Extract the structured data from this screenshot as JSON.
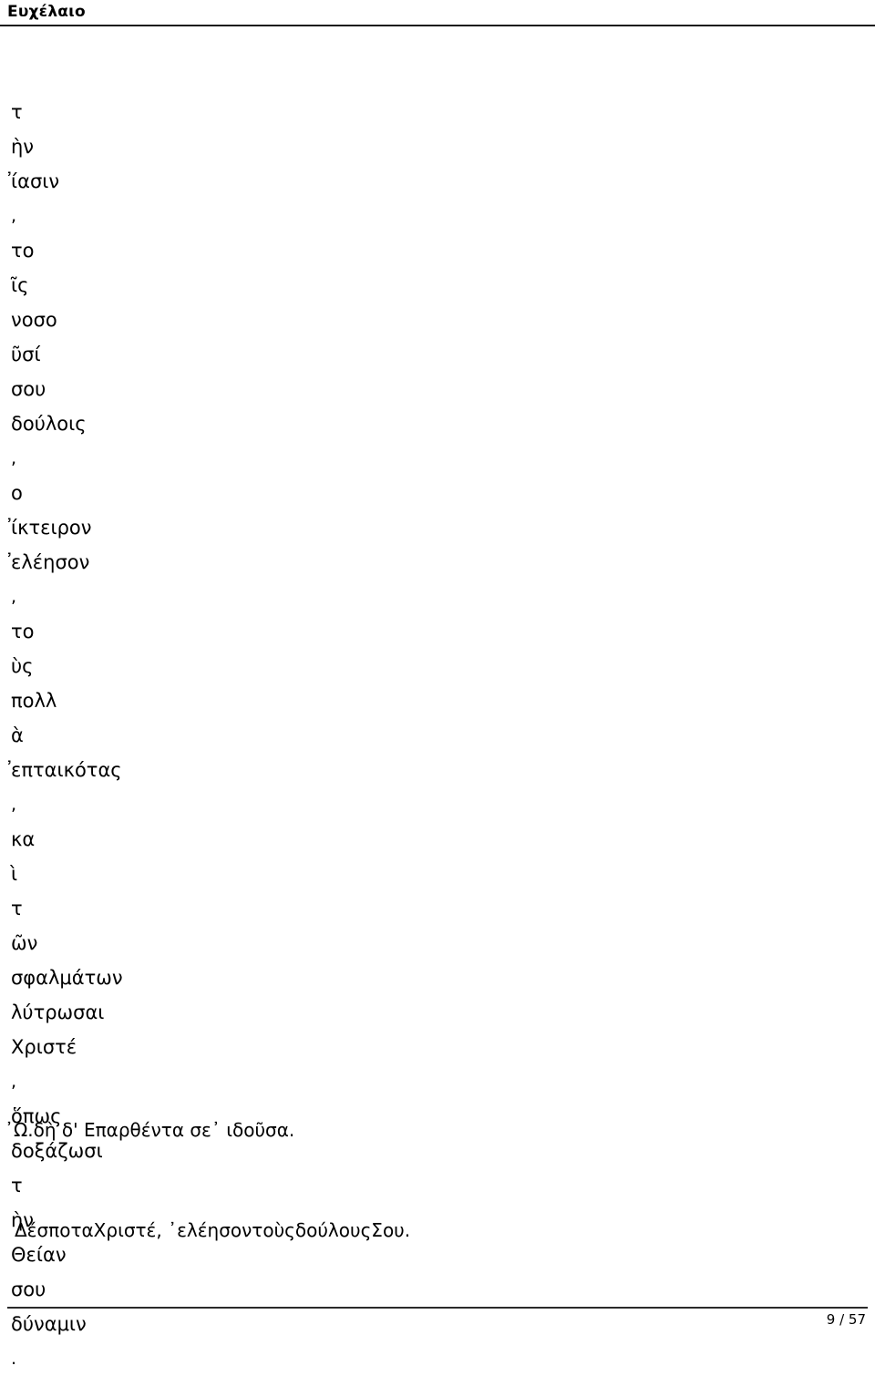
{
  "header": {
    "title": "Ευχέλαιο"
  },
  "main": {
    "fragment_lines": [
      {
        "text": "τ",
        "type": "word",
        "leading_mark": ""
      },
      {
        "text": "ὴν",
        "type": "word",
        "leading_mark": ""
      },
      {
        "text": "ίασιν",
        "type": "word",
        "leading_mark": "᾿"
      },
      {
        "text": ",",
        "type": "punct",
        "leading_mark": ""
      },
      {
        "text": "το",
        "type": "word",
        "leading_mark": ""
      },
      {
        "text": "ῖς",
        "type": "word",
        "leading_mark": ""
      },
      {
        "text": "νοσο",
        "type": "word",
        "leading_mark": ""
      },
      {
        "text": "ῦσί",
        "type": "word",
        "leading_mark": ""
      },
      {
        "text": "σου",
        "type": "word",
        "leading_mark": ""
      },
      {
        "text": "δούλοις",
        "type": "word",
        "leading_mark": ""
      },
      {
        "text": ",",
        "type": "punct",
        "leading_mark": ""
      },
      {
        "text": "ο",
        "type": "word",
        "leading_mark": ""
      },
      {
        "text": "ίκτειρον",
        "type": "word",
        "leading_mark": "᾿"
      },
      {
        "text": "ελέησον",
        "type": "word",
        "leading_mark": "᾿"
      },
      {
        "text": ",",
        "type": "punct",
        "leading_mark": ""
      },
      {
        "text": "το",
        "type": "word",
        "leading_mark": ""
      },
      {
        "text": "ὺς",
        "type": "word",
        "leading_mark": ""
      },
      {
        "text": "πολλ",
        "type": "word",
        "leading_mark": ""
      },
      {
        "text": "ὰ",
        "type": "word",
        "leading_mark": ""
      },
      {
        "text": "επταικότας",
        "type": "word",
        "leading_mark": "᾿"
      },
      {
        "text": ",",
        "type": "punct",
        "leading_mark": ""
      },
      {
        "text": "κα",
        "type": "word",
        "leading_mark": ""
      },
      {
        "text": "ὶ",
        "type": "word",
        "leading_mark": ""
      },
      {
        "text": "τ",
        "type": "word",
        "leading_mark": ""
      },
      {
        "text": "ῶν",
        "type": "word",
        "leading_mark": ""
      },
      {
        "text": "σφαλμάτων",
        "type": "word",
        "leading_mark": ""
      },
      {
        "text": "λύτρωσαι",
        "type": "word",
        "leading_mark": ""
      },
      {
        "text": "Χριστέ",
        "type": "word",
        "leading_mark": ""
      },
      {
        "text": ",",
        "type": "punct",
        "leading_mark": ""
      },
      {
        "text": "ὅπως",
        "type": "word",
        "leading_mark": ""
      },
      {
        "text": "δοξάζωσι",
        "type": "word",
        "leading_mark": ""
      },
      {
        "text": "τ",
        "type": "word",
        "leading_mark": ""
      },
      {
        "text": "ὴν",
        "type": "word",
        "leading_mark": ""
      },
      {
        "text": "Θείαν",
        "type": "word",
        "leading_mark": ""
      },
      {
        "text": "σου",
        "type": "word",
        "leading_mark": ""
      },
      {
        "text": "δύναμιν",
        "type": "word",
        "leading_mark": ""
      },
      {
        "text": ".",
        "type": "punct",
        "leading_mark": ""
      }
    ],
    "ode_heading": "᾿Ω.δὴ δ' Επαρθέντα σε᾿ ιδοῦσα.",
    "prayer_line": "ΔέσποταΧριστέ, ᾿ελέησοντοὺςδούλουςΣου."
  },
  "footer": {
    "page_number": "9 / 57"
  }
}
